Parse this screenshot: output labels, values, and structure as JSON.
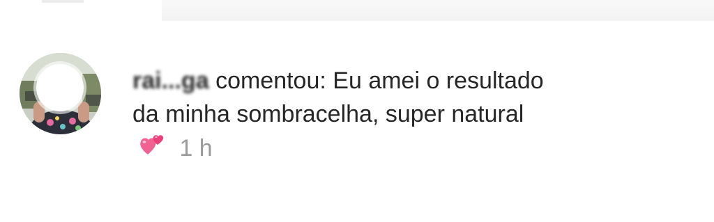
{
  "notification": {
    "username": "rai...ga",
    "action": "comentou:",
    "comment": "Eu amei o resultado da minha sombracelha, super natural",
    "emoji": "two-hearts-icon",
    "time": "1 h"
  },
  "colors": {
    "text": "#262626",
    "time": "#9a9a9a",
    "heart": "#f06292"
  }
}
